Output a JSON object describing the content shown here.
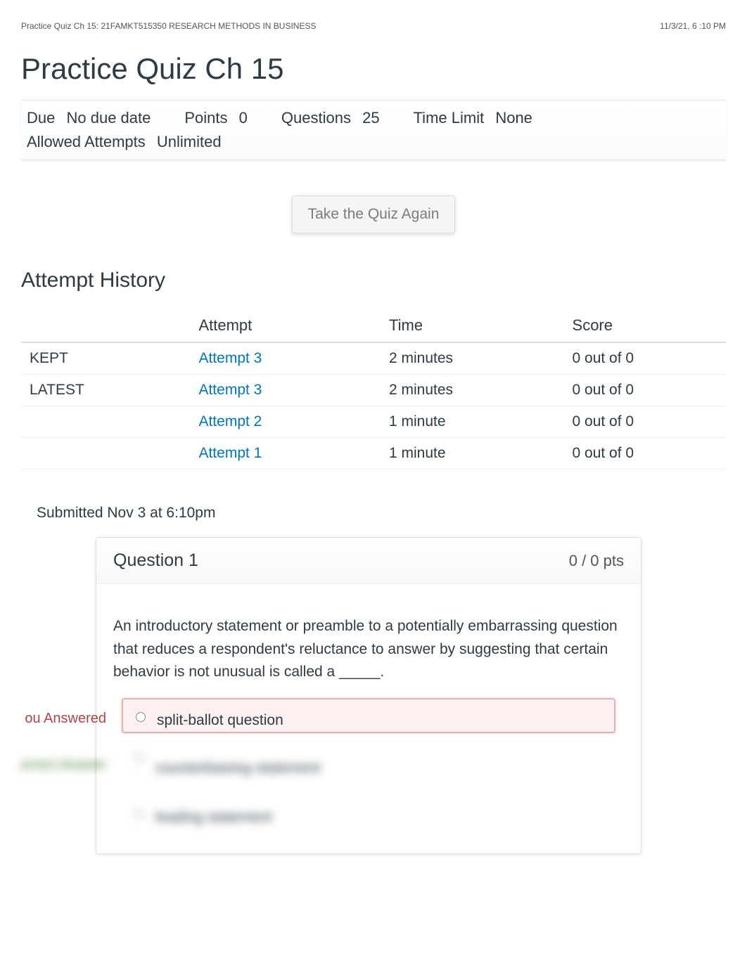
{
  "header": {
    "breadcrumb": "Practice Quiz Ch 15: 21FAMKT515350 RESEARCH METHODS IN BUSINESS",
    "timestamp": "11/3/21, 6 :10 PM"
  },
  "quiz": {
    "title": "Practice Quiz Ch 15",
    "meta": [
      {
        "label": "Due",
        "value": "No due date"
      },
      {
        "label": "Points",
        "value": "0"
      },
      {
        "label": "Questions",
        "value": "25"
      },
      {
        "label": "Time Limit",
        "value": "None"
      },
      {
        "label": "Allowed Attempts",
        "value": "Unlimited"
      }
    ],
    "take_again_label": "Take the Quiz Again"
  },
  "history": {
    "title": "Attempt History",
    "columns": [
      "",
      "Attempt",
      "Time",
      "Score"
    ],
    "rows": [
      {
        "tag": "KEPT",
        "attempt": "Attempt 3",
        "time": "2 minutes",
        "score": "0 out of 0"
      },
      {
        "tag": "LATEST",
        "attempt": "Attempt 3",
        "time": "2 minutes",
        "score": "0 out of 0"
      },
      {
        "tag": "",
        "attempt": "Attempt 2",
        "time": "1 minute",
        "score": "0 out of 0"
      },
      {
        "tag": "",
        "attempt": "Attempt 1",
        "time": "1 minute",
        "score": "0 out of 0"
      }
    ]
  },
  "submitted": "Submitted Nov 3 at 6:10pm",
  "question": {
    "label": "Question 1",
    "pts": "0 / 0 pts",
    "text": "An introductory statement or preamble to a potentially embarrassing question that reduces a respondent's reluctance to answer by suggesting that certain behavior is not unusual is called a _____.",
    "you_answered_label": "ou Answered",
    "correct_answer_label": "orrect Answer",
    "answers": [
      {
        "type": "selected-wrong",
        "text": "split-ballot question"
      },
      {
        "type": "correct",
        "text": "counterbiasing statement"
      },
      {
        "type": "plain",
        "text": "leading statement"
      }
    ]
  }
}
